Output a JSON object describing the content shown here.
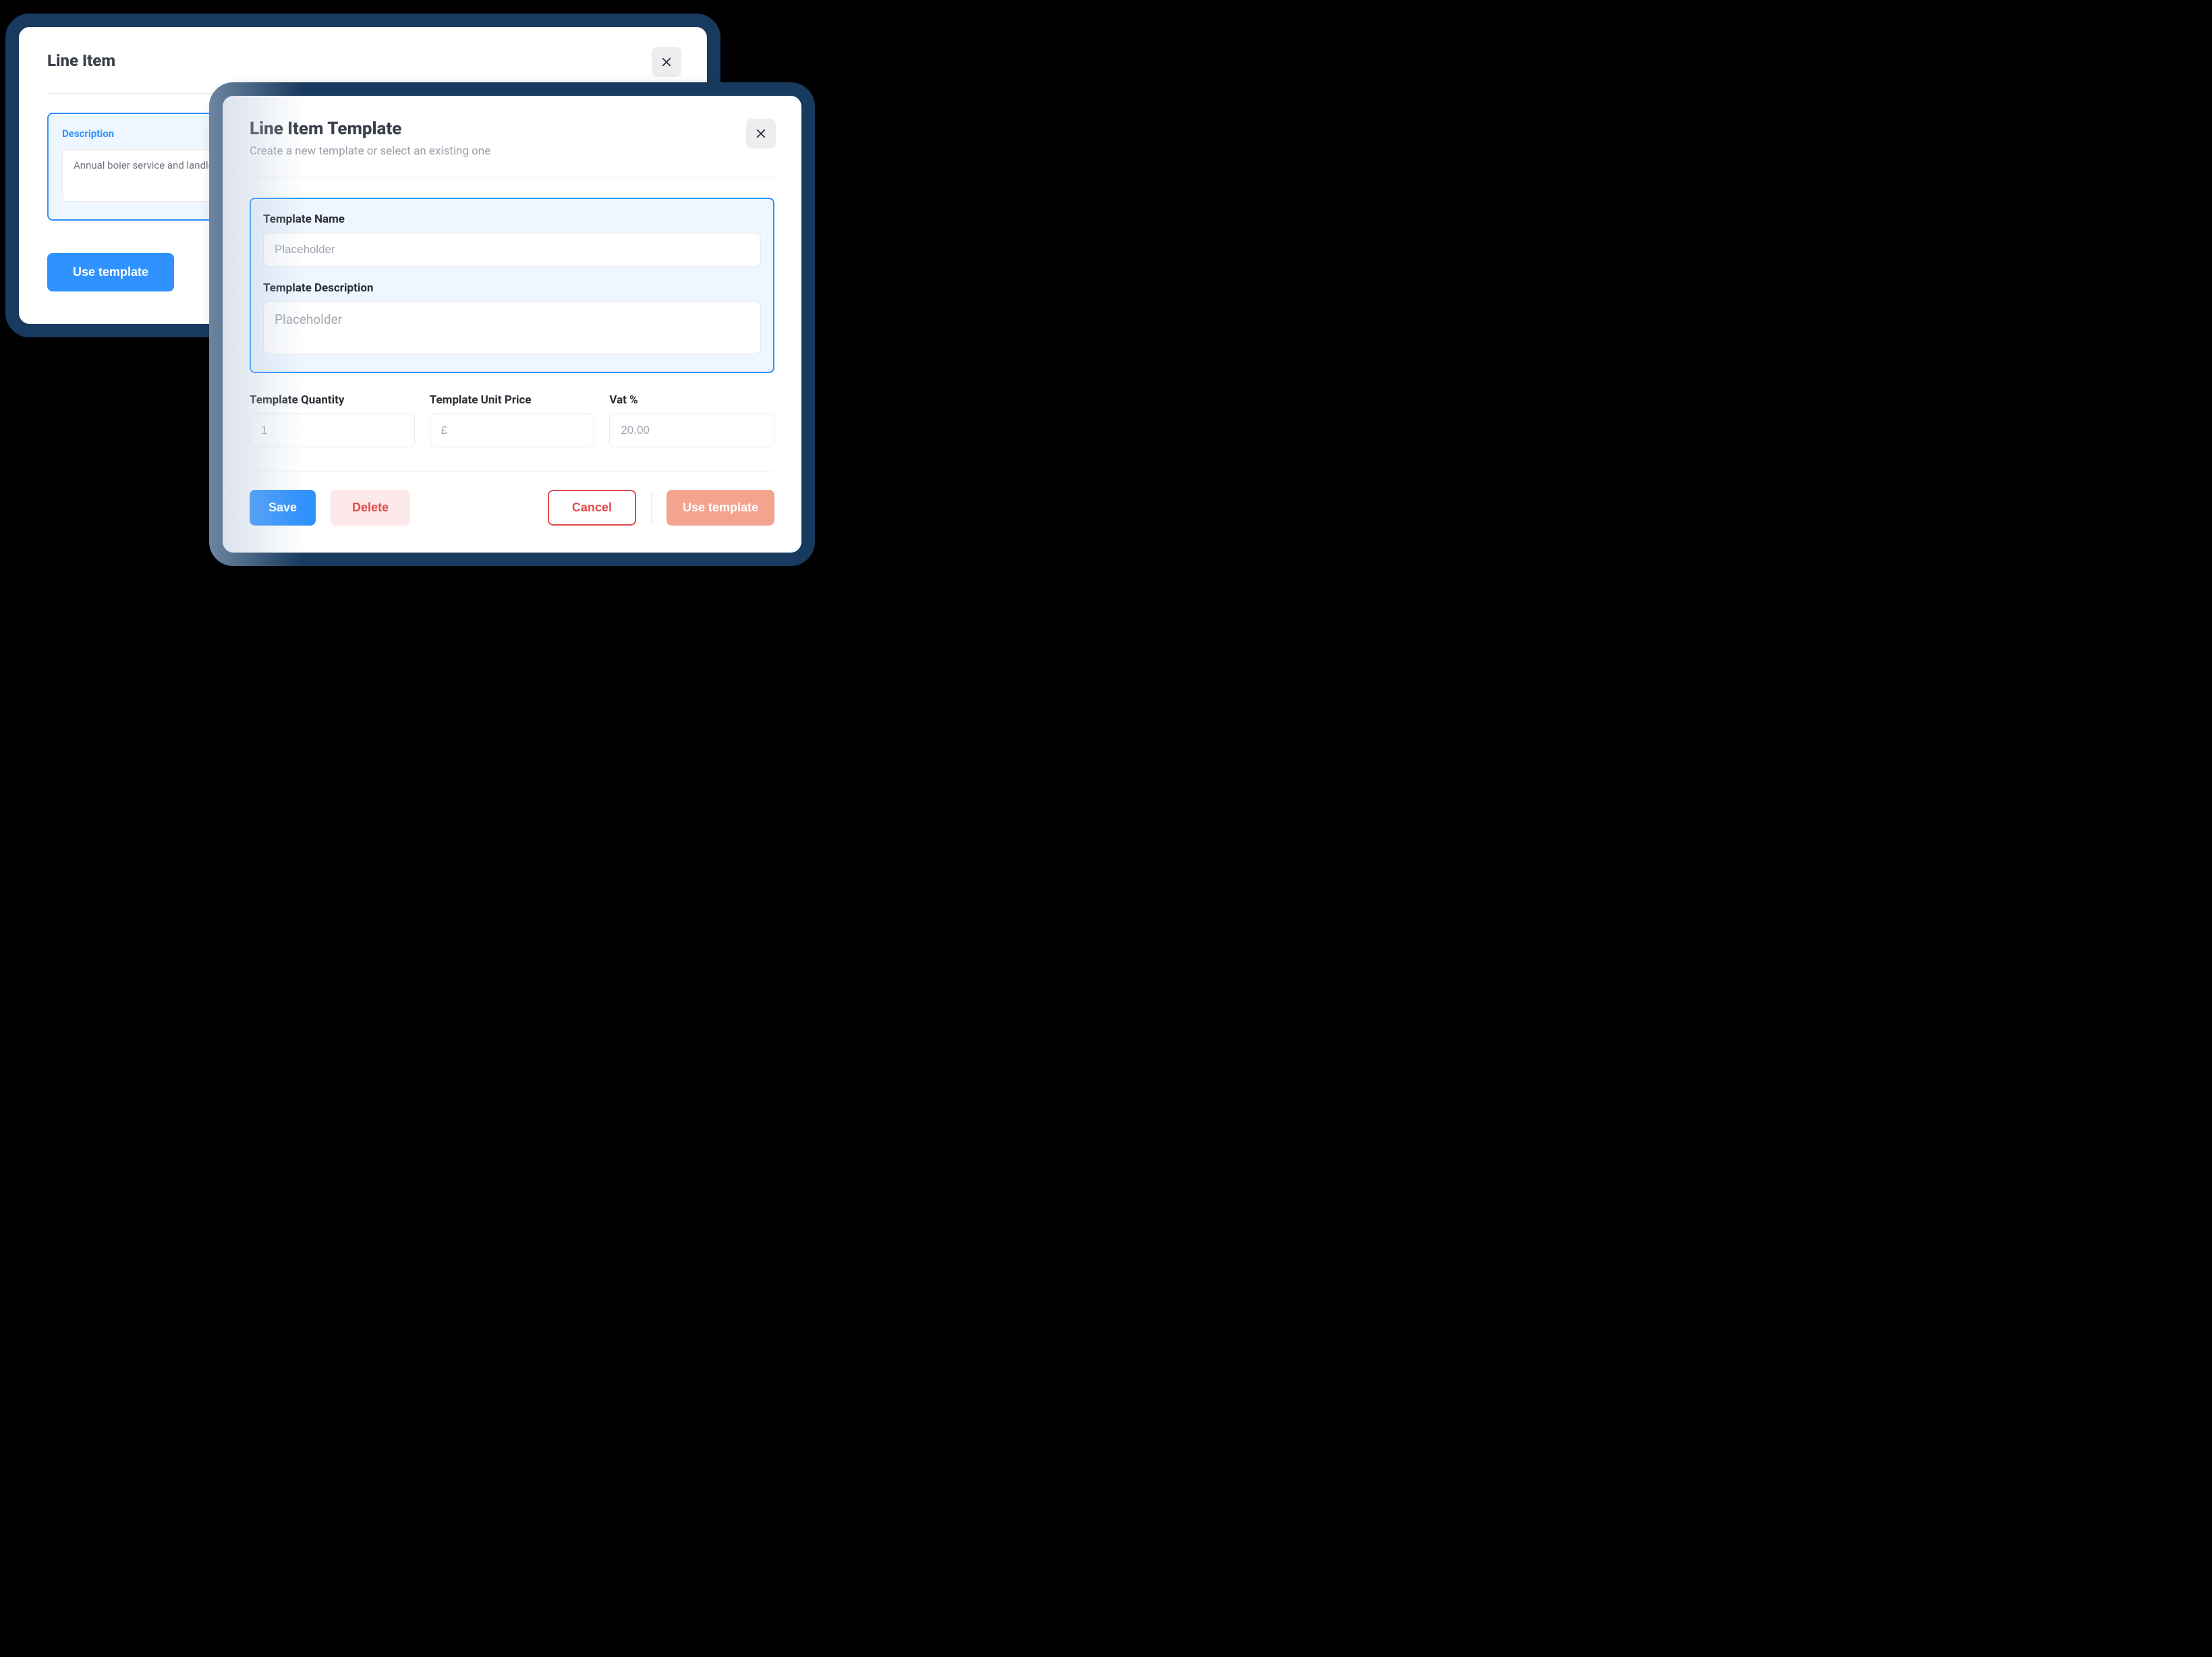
{
  "back": {
    "title": "Line Item",
    "description_label": "Description",
    "description_value": "Annual boier service and landlor",
    "use_template_label": "Use template"
  },
  "front": {
    "title": "Line Item Template",
    "subtitle": "Create a new template or select an existing one",
    "template_name_label": "Template Name",
    "template_name_placeholder": "Placeholder",
    "template_desc_label": "Template Description",
    "template_desc_placeholder": "Placeholder",
    "qty_label": "Template Quantity",
    "qty_placeholder": "1",
    "price_label": "Template Unit Price",
    "price_placeholder": "£",
    "vat_label": "Vat %",
    "vat_placeholder": "20.00",
    "save_label": "Save",
    "delete_label": "Delete",
    "cancel_label": "Cancel",
    "use_template_label": "Use template"
  }
}
